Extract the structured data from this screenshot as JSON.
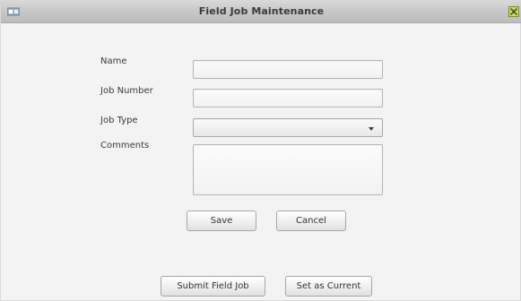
{
  "window": {
    "title": "Field Job Maintenance",
    "app_icon": "window-app-icon",
    "close_icon": "close-icon"
  },
  "form": {
    "name": {
      "label": "Name",
      "value": "",
      "placeholder": ""
    },
    "job_number": {
      "label": "Job Number",
      "value": "",
      "placeholder": ""
    },
    "job_type": {
      "label": "Job Type",
      "selected": "",
      "icon": "chevron-down-icon"
    },
    "comments": {
      "label": "Comments",
      "value": ""
    }
  },
  "buttons": {
    "save": "Save",
    "cancel": "Cancel",
    "submit_field_job": "Submit Field Job",
    "set_as_current": "Set as Current"
  },
  "colors": {
    "titlebar": "#c6c6c6",
    "background": "#f3f3f3",
    "close_icon": "#8fa64a"
  }
}
